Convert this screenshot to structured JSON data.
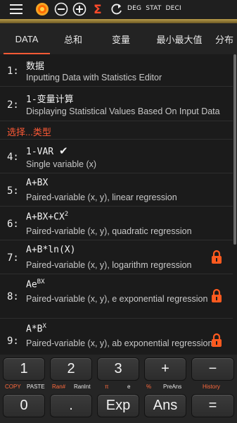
{
  "topbar": {
    "icons": [
      "menu-icon",
      "sun-theme-icon",
      "minus-circle-icon",
      "plus-circle-icon",
      "sigma-icon",
      "refresh-icon"
    ],
    "modes": [
      "DEG",
      "STAT",
      "DECI"
    ]
  },
  "tabs": [
    "DATA",
    "总和",
    "变量",
    "最小最大值",
    "分布"
  ],
  "rows": [
    {
      "num": "1:",
      "title": "数据",
      "desc": "Inputting Data with Statistics Editor",
      "locked": false
    },
    {
      "num": "2:",
      "title": "1-变量计算",
      "desc": "Displaying Statistical Values Based On Input Data",
      "locked": false
    }
  ],
  "section_label": "选择...类型",
  "types": [
    {
      "num": "4:",
      "title": "1-VAR",
      "check": "✔",
      "desc": "Single variable (x)",
      "locked": false
    },
    {
      "num": "5:",
      "title": "A+BX",
      "desc": "Paired-variable (x, y), linear regression",
      "locked": false
    },
    {
      "num": "6:",
      "title": "A+BX+CX",
      "sup": "2",
      "desc": "Paired-variable (x, y), quadratic regression",
      "locked": false
    },
    {
      "num": "7:",
      "title": "A+B*ln(X)",
      "desc": "Paired-variable (x, y), logarithm regression",
      "locked": true
    },
    {
      "num": "8:",
      "title": "Ae",
      "sup": "BX",
      "desc": "Paired-variable (x, y), e exponential regression",
      "locked": true
    },
    {
      "num": "9:",
      "title": "A*B",
      "sup": "X",
      "desc": "Paired-variable (x, y), ab exponential regression",
      "locked": true
    }
  ],
  "keypad": {
    "row1": [
      "1",
      "2",
      "3",
      "+",
      "−"
    ],
    "row2": [
      "0",
      ".",
      "Exp",
      "Ans",
      "="
    ],
    "sublabels": [
      "COPY",
      "PASTE",
      "Ran#",
      "RanInt",
      "π",
      "e",
      "%",
      "PreAns",
      "History"
    ]
  },
  "colors": {
    "accent": "#ff5a36",
    "lock": "#ff5a1f",
    "background": "#1b1b1b"
  }
}
